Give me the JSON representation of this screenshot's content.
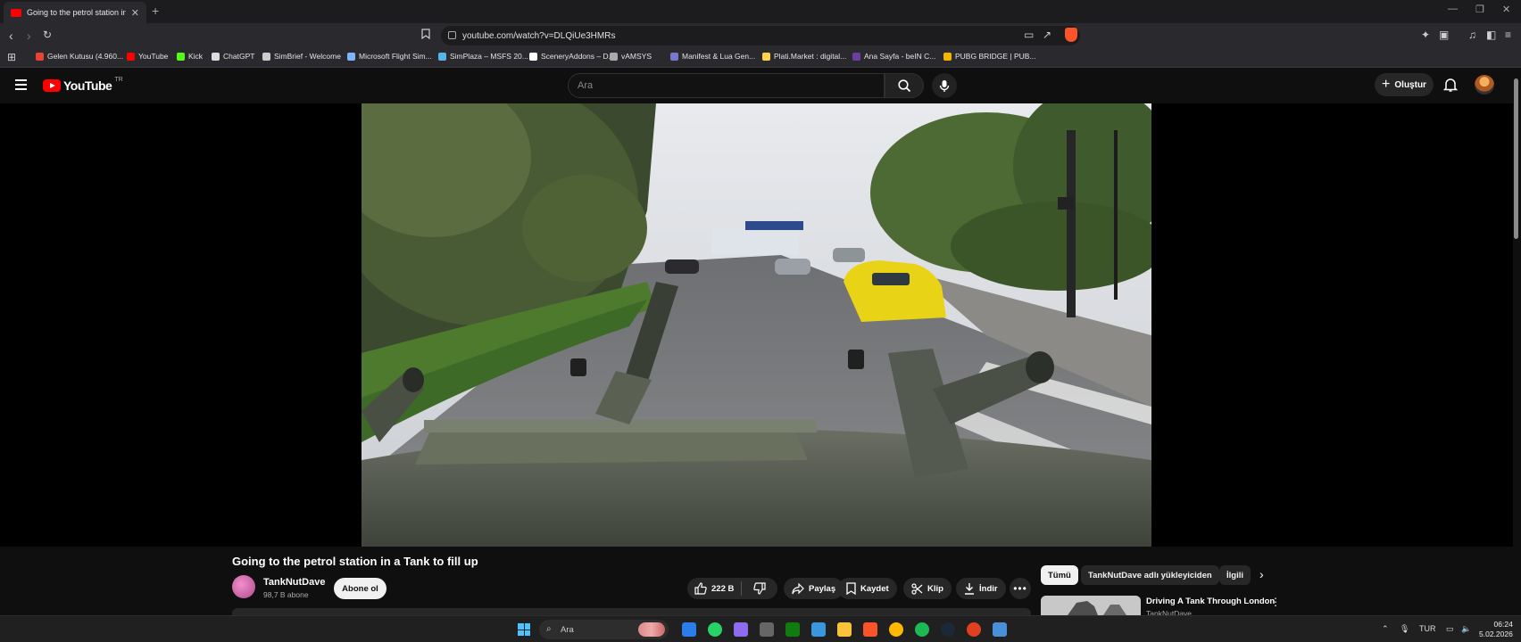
{
  "browser": {
    "tab_title": "Going to the petrol station in a Tank to fill up",
    "url": "youtube.com/watch?v=DLQiUe3HMRs",
    "bookmarks": [
      {
        "label": "Gelen Kutusu (4.960...",
        "icon_color": "#ea4335"
      },
      {
        "label": "YouTube",
        "icon_color": "#ff0000"
      },
      {
        "label": "Kick",
        "icon_color": "#53fc18"
      },
      {
        "label": "ChatGPT",
        "icon_color": "#dddddd"
      },
      {
        "label": "SimBrief - Welcome",
        "icon_color": "#cccccc"
      },
      {
        "label": "Microsoft Flight Sim...",
        "icon_color": "#7fb3ff"
      },
      {
        "label": "SimPlaza – MSFS 20...",
        "icon_color": "#56b4e9"
      },
      {
        "label": "SceneryAddons – D...",
        "icon_color": "#ffffff"
      },
      {
        "label": "vAMSYS",
        "icon_color": "#aaaaaa"
      },
      {
        "label": "Manifest & Lua Gen...",
        "icon_color": "#7777cc"
      },
      {
        "label": "Plati.Market : digital...",
        "icon_color": "#ffd24d"
      },
      {
        "label": "Ana Sayfa - beIN C...",
        "icon_color": "#6b3fa0"
      },
      {
        "label": "PUBG BRIDGE | PUB...",
        "icon_color": "#f2b600"
      }
    ]
  },
  "youtube": {
    "logo_text": "YouTube",
    "logo_region": "TR",
    "search_placeholder": "Ara",
    "create_label": "Oluştur"
  },
  "video": {
    "title": "Going to the petrol station in a Tank to fill up",
    "channel": "TankNutDave",
    "subscribers": "98,7 B abone",
    "subscribe_label": "Abone ol",
    "likes": "222 B",
    "share_label": "Paylaş",
    "save_label": "Kaydet",
    "clip_label": "Klip",
    "download_label": "İndir"
  },
  "sidebar": {
    "chips": [
      "Tümü",
      "TankNutDave adlı yükleyiciden",
      "İlgili"
    ],
    "recommendation": {
      "title": "Driving A Tank Through London",
      "channel": "TankNutDave"
    }
  },
  "taskbar": {
    "search_label": "Ara",
    "language": "TUR",
    "time": "06:24",
    "date": "5.02.2026",
    "apps": [
      {
        "name": "files-app-icon",
        "color": "#2b7de9"
      },
      {
        "name": "whatsapp-icon",
        "color": "#25d366"
      },
      {
        "name": "pen-app-icon",
        "color": "#8e6cf0"
      },
      {
        "name": "cube-app-icon",
        "color": "#666666"
      },
      {
        "name": "xbox-icon",
        "color": "#107c10"
      },
      {
        "name": "store-icon",
        "color": "#3a96dd"
      },
      {
        "name": "folder-icon",
        "color": "#f8c33a"
      },
      {
        "name": "brave-icon",
        "color": "#fb542b"
      },
      {
        "name": "discord-icon",
        "color": "#ffb800"
      },
      {
        "name": "spotify-icon",
        "color": "#1db954"
      },
      {
        "name": "steam-icon",
        "color": "#1b2838"
      },
      {
        "name": "app-red-icon",
        "color": "#e04020"
      },
      {
        "name": "settings-icon",
        "color": "#4a90d9"
      }
    ]
  }
}
